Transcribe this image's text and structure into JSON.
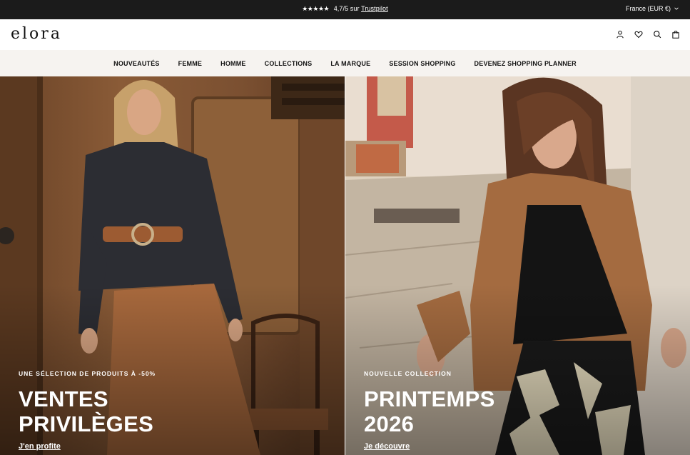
{
  "topbar": {
    "stars": "★★★★★",
    "rating": "4,7/5 sur",
    "trustpilot": "Trustpilot",
    "country": "France (EUR €)"
  },
  "header": {
    "logo": "elora"
  },
  "nav": {
    "items": [
      "NOUVEAUTÉS",
      "FEMME",
      "HOMME",
      "COLLECTIONS",
      "LA MARQUE",
      "SESSION SHOPPING",
      "DEVENEZ SHOPPING PLANNER"
    ]
  },
  "hero": {
    "left": {
      "eyebrow": "UNE SÉLECTION DE PRODUITS À -50%",
      "headline_line1": "VENTES",
      "headline_line2": "PRIVILÈGES",
      "cta": "J'en profite"
    },
    "right": {
      "eyebrow": "NOUVELLE COLLECTION",
      "headline_line1": "PRINTEMPS",
      "headline_line2": "2026",
      "cta": "Je découvre"
    }
  },
  "icons": {
    "account": "user-icon",
    "wishlist": "heart-icon",
    "search": "search-icon",
    "cart": "bag-icon",
    "country_dropdown": "chevron-down-icon"
  },
  "colors": {
    "topbar_bg": "#1b1b1b",
    "nav_bg": "#f6f3f0",
    "hero_text": "#ffffff"
  }
}
